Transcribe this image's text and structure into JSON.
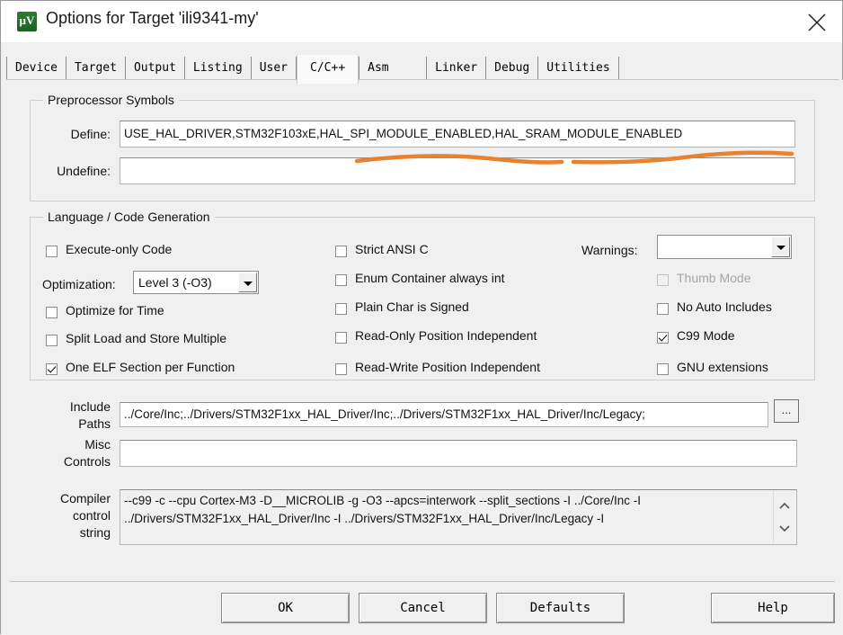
{
  "window": {
    "title": "Options for Target 'ili9341-my'",
    "icon": "keil-uvision-icon",
    "close_label": "×"
  },
  "tabs": [
    {
      "label": "Device",
      "selected": false
    },
    {
      "label": "Target",
      "selected": false
    },
    {
      "label": "Output",
      "selected": false
    },
    {
      "label": "Listing",
      "selected": false
    },
    {
      "label": "User",
      "selected": false
    },
    {
      "label": "C/C++",
      "selected": true
    },
    {
      "label": "Asm",
      "selected": false
    },
    {
      "label": "Linker",
      "selected": false
    },
    {
      "label": "Debug",
      "selected": false
    },
    {
      "label": "Utilities",
      "selected": false
    }
  ],
  "preprocessor": {
    "group_title": "Preprocessor Symbols",
    "define_label": "Define:",
    "define_value": "USE_HAL_DRIVER,STM32F103xE,HAL_SPI_MODULE_ENABLED,HAL_SRAM_MODULE_ENABLED",
    "undefine_label": "Undefine:",
    "undefine_value": ""
  },
  "language": {
    "group_title": "Language / Code Generation",
    "optimization_label": "Optimization:",
    "optimization_value": "Level 3 (-O3)",
    "warnings_label": "Warnings:",
    "warnings_value": "",
    "column1": [
      {
        "label": "Execute-only Code",
        "checked": false,
        "disabled": false
      },
      {
        "label": "Optimize for Time",
        "checked": false,
        "disabled": false
      },
      {
        "label": "Split Load and Store Multiple",
        "checked": false,
        "disabled": false
      },
      {
        "label": "One ELF Section per Function",
        "checked": true,
        "disabled": false
      }
    ],
    "column2": [
      {
        "label": "Strict ANSI C",
        "checked": false,
        "disabled": false
      },
      {
        "label": "Enum Container always int",
        "checked": false,
        "disabled": false
      },
      {
        "label": "Plain Char is Signed",
        "checked": false,
        "disabled": false
      },
      {
        "label": "Read-Only Position Independent",
        "checked": false,
        "disabled": false
      },
      {
        "label": "Read-Write Position Independent",
        "checked": false,
        "disabled": false
      }
    ],
    "column3": [
      {
        "label": "Thumb Mode",
        "checked": false,
        "disabled": true
      },
      {
        "label": "No Auto Includes",
        "checked": false,
        "disabled": false
      },
      {
        "label": "C99 Mode",
        "checked": true,
        "disabled": false
      },
      {
        "label": "GNU extensions",
        "checked": false,
        "disabled": false
      }
    ]
  },
  "paths": {
    "include_label_line1": "Include",
    "include_label_line2": "Paths",
    "include_value": "../Core/Inc;../Drivers/STM32F1xx_HAL_Driver/Inc;../Drivers/STM32F1xx_HAL_Driver/Inc/Legacy;",
    "browse_label": "...",
    "misc_label_line1": "Misc",
    "misc_label_line2": "Controls",
    "misc_value": "",
    "compiler_label_line1": "Compiler",
    "compiler_label_line2": "control",
    "compiler_label_line3": "string",
    "compiler_value": "--c99 -c --cpu Cortex-M3 -D__MICROLIB -g -O3 --apcs=interwork --split_sections -I ../Core/Inc -I\n../Drivers/STM32F1xx_HAL_Driver/Inc -I ../Drivers/STM32F1xx_HAL_Driver/Inc/Legacy -I",
    "scroll_up": "scroll-up-icon",
    "scroll_down": "scroll-down-icon"
  },
  "footer": {
    "ok_label": "OK",
    "cancel_label": "Cancel",
    "defaults_label": "Defaults",
    "help_label": "Help"
  },
  "annotation": {
    "color": "#e8822e",
    "marks": [
      "underline-hal-spi-module-enabled",
      "underline-hal-sram-module-enabled"
    ]
  }
}
